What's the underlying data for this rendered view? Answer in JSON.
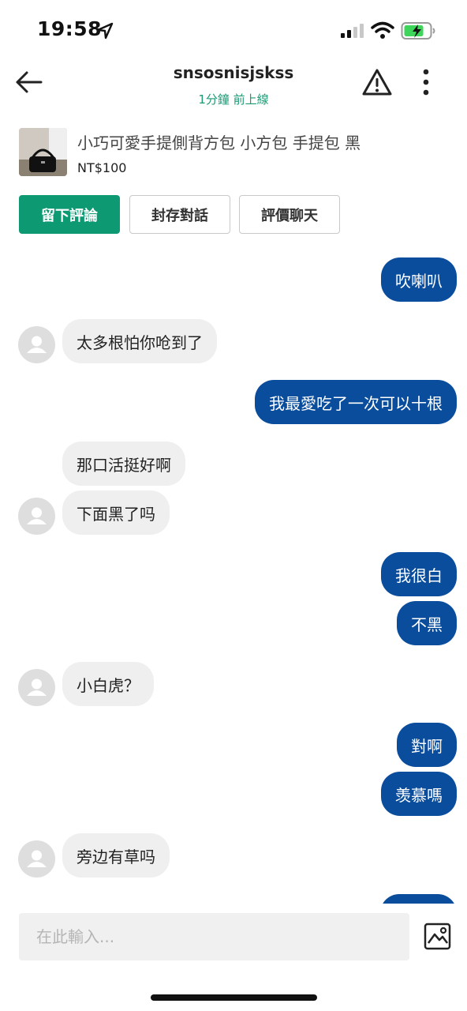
{
  "status_bar": {
    "time": "19:58"
  },
  "header": {
    "title": "snsosnisjskss",
    "subtitle": "1分鐘 前上線",
    "icons": [
      "back-arrow-icon",
      "warning-icon",
      "more-vertical-icon"
    ]
  },
  "product": {
    "name": "小巧可愛手提側背方包 小方包 手提包 黑",
    "price": "NT$100"
  },
  "actions": {
    "review": "留下評論",
    "archive": "封存對話",
    "rate": "評價聊天"
  },
  "messages": [
    {
      "from": "me",
      "text": "吹喇叭"
    },
    {
      "from": "them",
      "text": "太多根怕你呛到了"
    },
    {
      "from": "me",
      "text": "我最愛吃了一次可以十根"
    },
    {
      "from": "them",
      "text": "那口活挺好啊"
    },
    {
      "from": "them",
      "text": "下面黑了吗"
    },
    {
      "from": "me",
      "text": "我很白"
    },
    {
      "from": "me",
      "text": "不黑"
    },
    {
      "from": "them",
      "text": "小白虎？"
    },
    {
      "from": "me",
      "text": "對啊"
    },
    {
      "from": "me",
      "text": "羡慕嗎"
    },
    {
      "from": "them",
      "text": "旁边有草吗"
    }
  ],
  "composer": {
    "placeholder": "在此輸入..."
  },
  "colors": {
    "accent": "#0d9a73",
    "outgoing_bubble": "#0a4d9c",
    "incoming_bubble": "#efefef",
    "online_text": "#1b9a74"
  }
}
